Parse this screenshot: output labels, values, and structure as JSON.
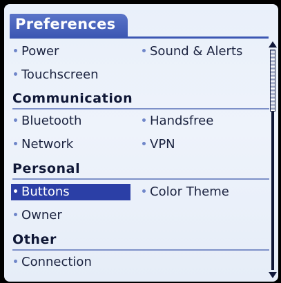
{
  "app": {
    "title": "Preferences"
  },
  "sections": {
    "general": {
      "items": [
        {
          "label": "Power"
        },
        {
          "label": "Sound & Alerts"
        },
        {
          "label": "Touchscreen"
        }
      ]
    },
    "communication": {
      "heading": "Communication",
      "items": [
        {
          "label": "Bluetooth"
        },
        {
          "label": "Handsfree"
        },
        {
          "label": "Network"
        },
        {
          "label": "VPN"
        }
      ]
    },
    "personal": {
      "heading": "Personal",
      "items": [
        {
          "label": "Buttons",
          "selected": true
        },
        {
          "label": "Color Theme"
        },
        {
          "label": "Owner"
        }
      ]
    },
    "other": {
      "heading": "Other",
      "items": [
        {
          "label": "Connection"
        }
      ]
    }
  },
  "scrollbar": {
    "position_fraction": 0.0
  },
  "colors": {
    "title_bar": "#3c57b3",
    "selection": "#2b3fa6",
    "background": "#eef3fb",
    "bullet": "#6f86c9"
  }
}
